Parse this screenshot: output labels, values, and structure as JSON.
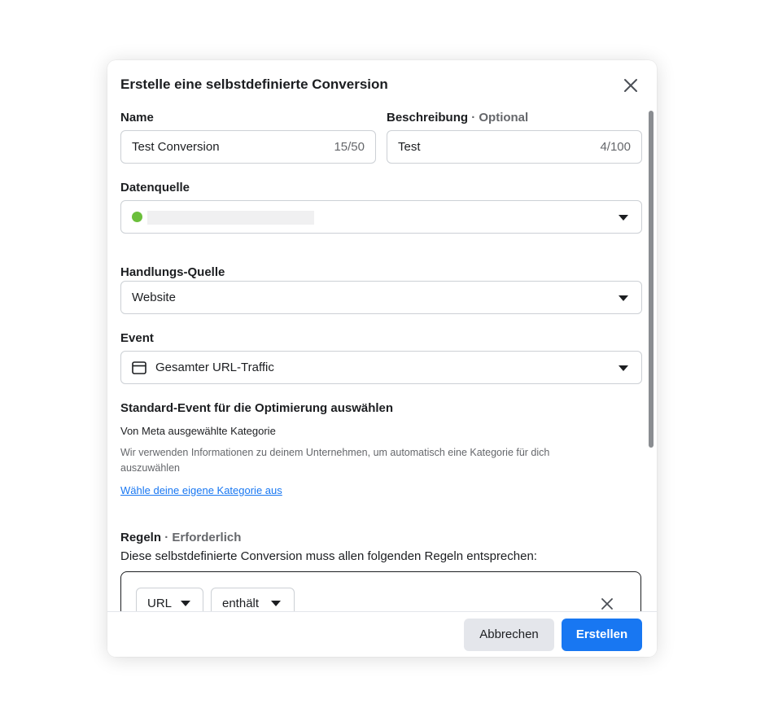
{
  "dialog": {
    "title": "Erstelle eine selbstdefinierte Conversion"
  },
  "name_field": {
    "label": "Name",
    "value": "Test Conversion",
    "counter": "15/50"
  },
  "description_field": {
    "label": "Beschreibung",
    "optional_marker": "· Optional",
    "value": "Test",
    "counter": "4/100"
  },
  "datasource": {
    "label": "Datenquelle",
    "status_color": "#6bbf3b"
  },
  "action_source": {
    "label": "Handlungs-Quelle",
    "value": "Website"
  },
  "event": {
    "label": "Event",
    "value": "Gesamter URL-Traffic",
    "icon": "browser-window-icon"
  },
  "standard_event": {
    "heading": "Standard-Event für die Optimierung auswählen",
    "category": "Von Meta ausgewählte Kategorie",
    "help": "Wir verwenden Informationen zu deinem Unternehmen, um automatisch eine Kategorie für dich auszuwählen",
    "link": "Wähle deine eigene Kategorie aus"
  },
  "rules": {
    "label": "Regeln",
    "required_marker": "· Erforderlich",
    "description": "Diese selbstdefinierte Conversion muss allen folgenden Regeln entsprechen:",
    "rule": {
      "field": "URL",
      "operator": "enthält"
    }
  },
  "footer": {
    "cancel_label": "Abbrechen",
    "create_label": "Erstellen"
  },
  "colors": {
    "primary": "#1877f2",
    "link": "#1877f2"
  }
}
